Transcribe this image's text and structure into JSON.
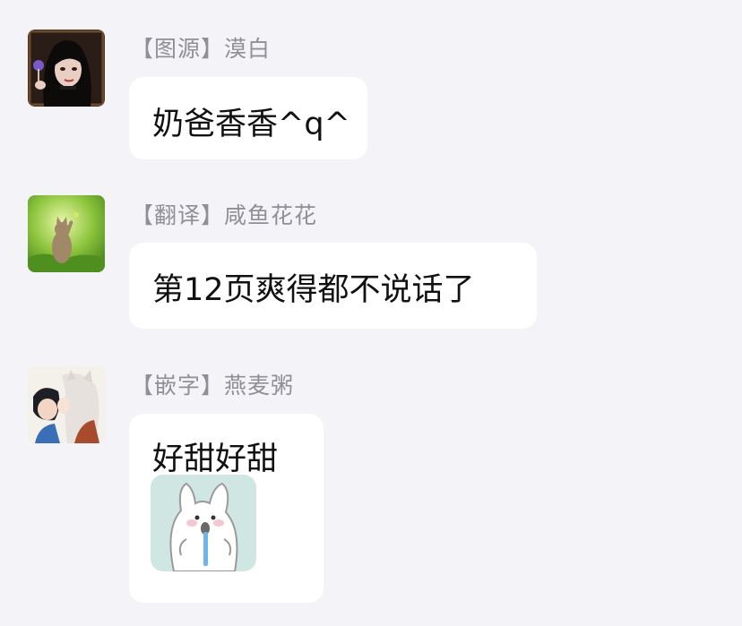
{
  "messages": [
    {
      "sender_tag": "【图源】",
      "sender_name": "漠白",
      "text": "奶爸香香^q^",
      "avatar_icon": "avatar-girl-dark-hair"
    },
    {
      "sender_tag": "【翻译】",
      "sender_name": "咸鱼花花",
      "text": "第12页爽得都不说话了",
      "avatar_icon": "avatar-cat-on-grass"
    },
    {
      "sender_tag": "【嵌字】",
      "sender_name": "燕麦粥",
      "text": "好甜好甜",
      "avatar_icon": "avatar-anime-couple",
      "sticker_icon": "white-bunny-sticker"
    }
  ],
  "colors": {
    "background": "#f3f3f8",
    "bubble": "#ffffff",
    "name_text": "#8f8f95",
    "message_text": "#111111"
  }
}
